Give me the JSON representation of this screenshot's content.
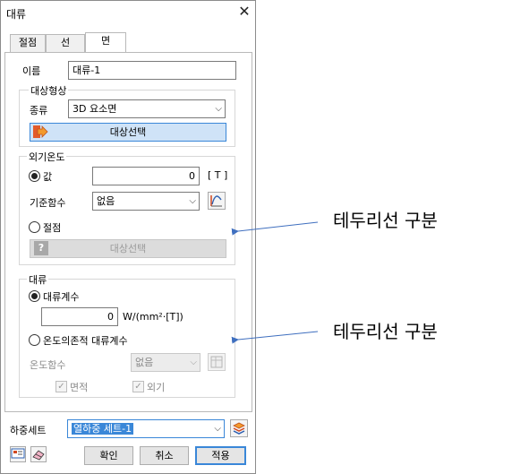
{
  "dialog": {
    "title": "대류",
    "close_icon": "close-icon",
    "tabs": [
      {
        "label": "절점",
        "active": false
      },
      {
        "label": "선",
        "active": false
      },
      {
        "label": "면",
        "active": true
      }
    ]
  },
  "name": {
    "label": "이름",
    "value": "대류-1"
  },
  "target": {
    "legend": "대상형상",
    "kind_label": "종류",
    "kind_value": "3D 요소면",
    "select_button": "대상선택",
    "select_icon": "arrow-right-icon"
  },
  "ambient": {
    "legend": "외기온도",
    "value_label": "값",
    "value": "0",
    "unit": "[ T ]",
    "func_label": "기준함수",
    "func_value": "없음",
    "func_icon": "function-graph-icon",
    "node_label": "절점",
    "node_button": "대상선택",
    "node_icon": "question-icon"
  },
  "convection": {
    "legend": "대류",
    "coef_label": "대류계수",
    "coef_value": "0",
    "coef_unit": "W/(mm²·[T])",
    "temp_dep_label": "온도의존적 대류계수",
    "temp_func_label": "온도함수",
    "temp_func_value": "없음",
    "temp_func_icon": "function-table-icon",
    "area_label": "면적",
    "ambient_label": "외기"
  },
  "loadset": {
    "label": "하중세트",
    "value": "열하중 세트-1",
    "icon": "loadset-stack-icon"
  },
  "footer": {
    "ok": "확인",
    "cancel": "취소",
    "apply": "적용",
    "left_icon_1": "display-icon",
    "left_icon_2": "eraser-icon"
  },
  "annotations": [
    {
      "text": "테두리선 구분"
    },
    {
      "text": "테두리선 구분"
    }
  ],
  "colors": {
    "accent": "#3a87d8",
    "select_bg": "#cfe3f7",
    "annotation_arrow": "#3f6fbf"
  }
}
